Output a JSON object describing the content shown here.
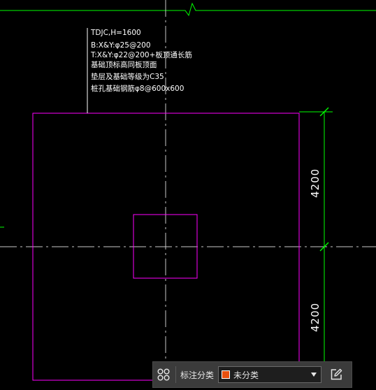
{
  "annotation": {
    "lines": [
      "TDJC,H=1600",
      "B:X&Y:φ25@200",
      "T:X&Y:φ22@200+板顶通长筋",
      "基础顶标高同板顶面",
      "垫层及基础等级为C35",
      "桩孔基础钢筋φ8@600x600"
    ]
  },
  "dimensions": {
    "upper": "4200",
    "lower": "4200"
  },
  "toolbar": {
    "grid_icon": "four-circles-icon",
    "label": "标注分类",
    "select_value": "未分类",
    "select_swatch_color": "#e8500f",
    "edit_icon": "edit-note-icon"
  },
  "colors": {
    "background": "#000000",
    "magenta_outline": "#ff00ff",
    "green_axis": "#00ff00",
    "centerline": "#c8c8c8",
    "text": "#ffffff"
  }
}
